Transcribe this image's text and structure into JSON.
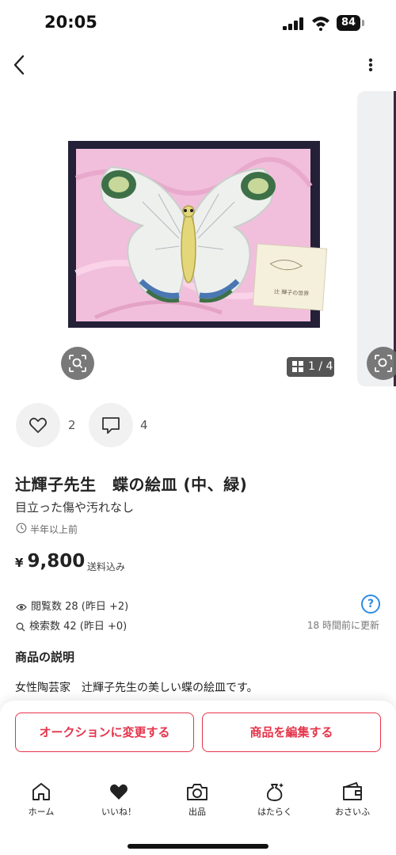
{
  "status_bar": {
    "time": "20:05",
    "battery": "84"
  },
  "gallery": {
    "counter": "1 / 4",
    "box_label": "辻 輝子の世界"
  },
  "reactions": {
    "likes": "2",
    "comments": "4"
  },
  "item": {
    "title": "辻輝子先生　蝶の絵皿 (中、緑)",
    "condition": "目立った傷や汚れなし",
    "listed": "半年以上前",
    "price_symbol": "¥",
    "price": "9,800",
    "shipping": "送料込み"
  },
  "stats": {
    "views": "閲覧数  28 (昨日 +2)",
    "searches": "検索数  42 (昨日 +0)",
    "updated": "18 時間前に更新",
    "help": "?"
  },
  "description": {
    "heading": "商品の説明",
    "body": "女性陶芸家　辻輝子先生の美しい蝶の絵皿です。"
  },
  "actions": {
    "auction": "オークションに変更する",
    "edit": "商品を編集する"
  },
  "tabs": [
    {
      "label": "ホーム",
      "icon": "home-icon"
    },
    {
      "label": "いいね！",
      "icon": "heart-icon"
    },
    {
      "label": "出品",
      "icon": "camera-icon"
    },
    {
      "label": "はたらく",
      "icon": "money-bag-icon"
    },
    {
      "label": "おさいふ",
      "icon": "wallet-icon"
    }
  ],
  "colors": {
    "accent": "#e5344a",
    "info": "#2e8ce6"
  }
}
